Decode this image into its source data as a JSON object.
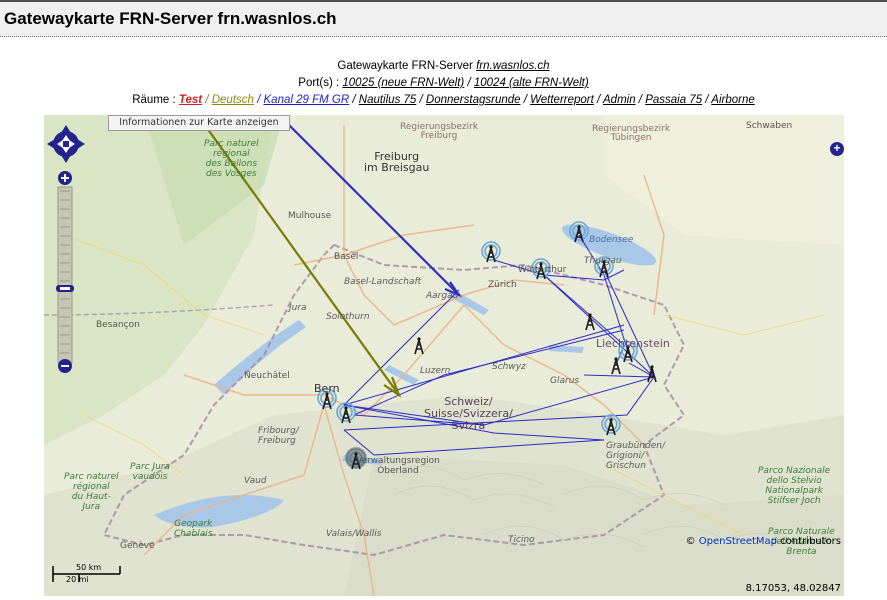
{
  "page": {
    "title": "Gatewaykarte FRN-Server frn.wasnlos.ch"
  },
  "info": {
    "heading_prefix": "Gatewaykarte FRN-Server ",
    "heading_link": "frn.wasnlos.ch",
    "ports_label": "Port(s) : ",
    "port_links": [
      "10025 (neue FRN-Welt)",
      "10024 (alte FRN-Welt)"
    ],
    "rooms_label": "Räume : ",
    "rooms": [
      {
        "label": "Test",
        "color": "#d42020"
      },
      {
        "label": "Deutsch",
        "color": "#8a8a10"
      },
      {
        "label": "Kanal 29 FM GR",
        "color": "#2020c8"
      },
      {
        "label": "Nautilus 75",
        "color": "#000000"
      },
      {
        "label": "Donnerstagsrunde",
        "color": "#000000"
      },
      {
        "label": "Wetterreport",
        "color": "#000000"
      },
      {
        "label": "Admin",
        "color": "#000000"
      },
      {
        "label": "Passaia 75",
        "color": "#000000"
      },
      {
        "label": "Airborne",
        "color": "#000000"
      }
    ]
  },
  "map": {
    "info_button": "Informationen zur Karte anzeigen",
    "attribution_prefix": "© ",
    "attribution_link": "OpenStreetMap",
    "attribution_suffix": " contributors",
    "coords": "8.17053, 48.02847",
    "scale_top": "50 km",
    "scale_bottom": "20 mi",
    "places": {
      "freiburg_bezirk": "Regierungsbezirk\nFreiburg",
      "tuebingen_bezirk": "Regierungsbezirk\nTübingen",
      "freiburg": "Freiburg\nim Breisgau",
      "mulhouse": "Mulhouse",
      "basel": "Basel",
      "basel_land": "Basel-Landschaft",
      "aargau": "Aargau",
      "zurich": "Zürich",
      "winterthur": "Winterthur",
      "thurgau": "Thurgau",
      "solothurn": "Solothurn",
      "jura": "Jura",
      "besancon": "Besançon",
      "neuchatel": "Neuchâtel",
      "luzern": "Luzern",
      "schwyz": "Schwyz",
      "glarus": "Glarus",
      "liechtenstein": "Liechtenstein",
      "bern": "Bern",
      "fribourg": "Fribourg/\nFreiburg",
      "switzerland": "Schweiz/\nSuisse/Svizzera/\nSvizra",
      "oberland": "Verwaltungsregion\nOberland",
      "graubunden": "Graubünden/\nGrigioni/\nGrischun",
      "vaud": "Vaud",
      "valais": "Valais/Wallis",
      "ticino": "Ticino",
      "geneve": "Genève",
      "schwaben": "Schwaben",
      "bodensee": "Bodensee",
      "park_vosges": "Parc naturel\nrégional\ndes Ballons\ndes Vosges",
      "park_jura_vaudois": "Parc naturel\nrégional\ndu Haut-\nJura",
      "park_jura_vd": "Parc Jura\nvaudois",
      "park_chablais": "Geopark\nChablais",
      "park_stelvio": "Parco Nazionale\ndello Stelvio\nNationalpark\nStilfser Joch",
      "park_adamello": "Parco Naturale\ndell'Adamello\nBrenta",
      "region_ch_partial": "Reg"
    }
  },
  "colors": {
    "deutsch_arrow": "#7a7a00",
    "kanal_arrow": "#3030c0",
    "link_lines": "#2a2acc",
    "control_blue": "#23238e"
  }
}
